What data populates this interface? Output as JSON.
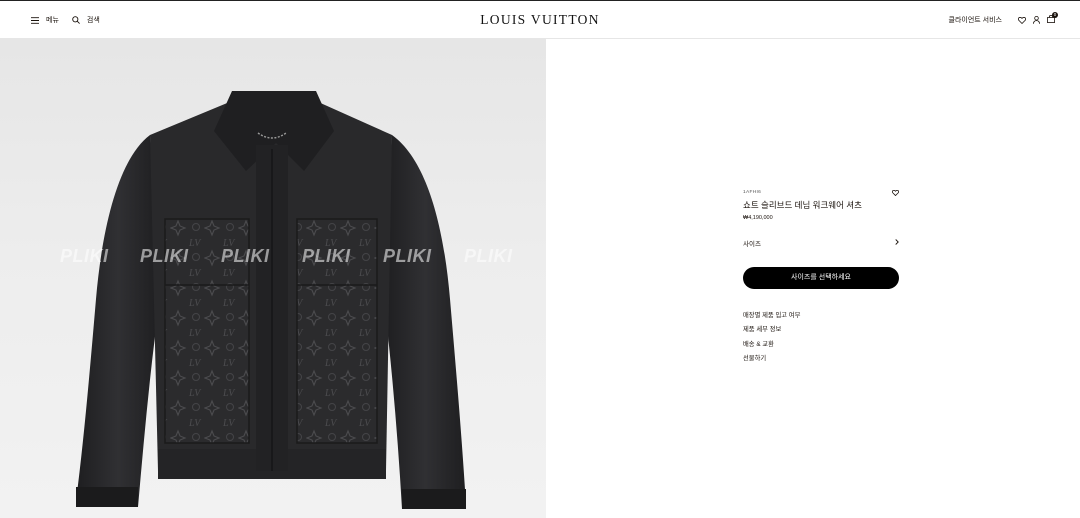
{
  "header": {
    "menu_label": "메뉴",
    "search_label": "검색",
    "logo": "LOUIS VUITTON",
    "client_services_label": "클라이언트 서비스",
    "bag_count": "0"
  },
  "gallery": {
    "watermarks": [
      "PLIKI",
      "PLIKI",
      "PLIKI",
      "PLIKI",
      "PLIKI",
      "PLIKI"
    ],
    "colors": {
      "background": "#ebebeb",
      "denim": "#2c2c2e"
    }
  },
  "product": {
    "sku": "1AFHI6",
    "name": "쇼트 슬리브드 데님 워크웨어 셔츠",
    "price": "₩4,190,000",
    "size_label": "사이즈",
    "cta_label": "사이즈를 선택하세요",
    "links": [
      "매장별 제품 입고 여부",
      "제품 세부 정보",
      "배송 & 교환",
      "선물하기"
    ]
  },
  "icons": {
    "menu": "hamburger-icon",
    "search": "search-icon",
    "wishlist": "heart-icon",
    "account": "user-icon",
    "bag": "shopping-bag-icon",
    "size_chevron": "chevron-right-icon"
  }
}
